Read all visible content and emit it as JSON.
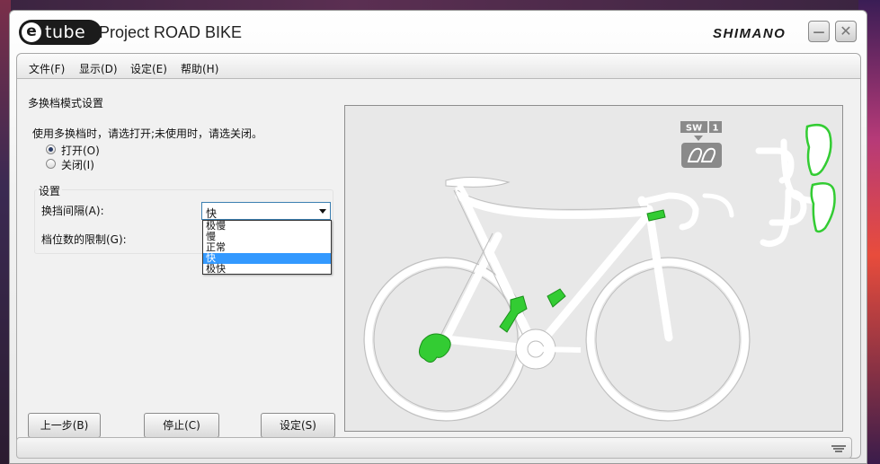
{
  "app": {
    "logo_letter": "e",
    "logo_word": "tube",
    "title": "Project  ROAD BIKE",
    "brand": "SHIMANO"
  },
  "window_controls": {
    "minimize": "—",
    "close": "✕"
  },
  "menu": [
    {
      "label": "文件(F)"
    },
    {
      "label": "显示(D)"
    },
    {
      "label": "设定(E)"
    },
    {
      "label": "帮助(H)"
    }
  ],
  "section": {
    "title": "多换档模式设置",
    "instruction": "使用多换档时，请选打开;未使用时，请选关闭。",
    "radio_on": "打开(O)",
    "radio_off": "关闭(I)",
    "radio_selected": "on"
  },
  "settings": {
    "group_label": "设置",
    "interval_label": "换挡间隔(A):",
    "interval_value": "快",
    "limit_label": "档位数的限制(G):",
    "options": [
      "极慢",
      "慢",
      "正常",
      "快",
      "极快"
    ],
    "selected_index": 3
  },
  "buttons": {
    "prev": "上一步(B)",
    "stop": "停止(C)",
    "set": "设定(S)"
  },
  "bike_panel": {
    "sw_label": "SW",
    "sw_number": "1",
    "highlight_color": "#33cc33",
    "frame_color": "#ffffff",
    "background_color": "#e6e6e6"
  },
  "colors": {
    "selection": "#3399ff",
    "select_border": "#3c7fb1"
  }
}
